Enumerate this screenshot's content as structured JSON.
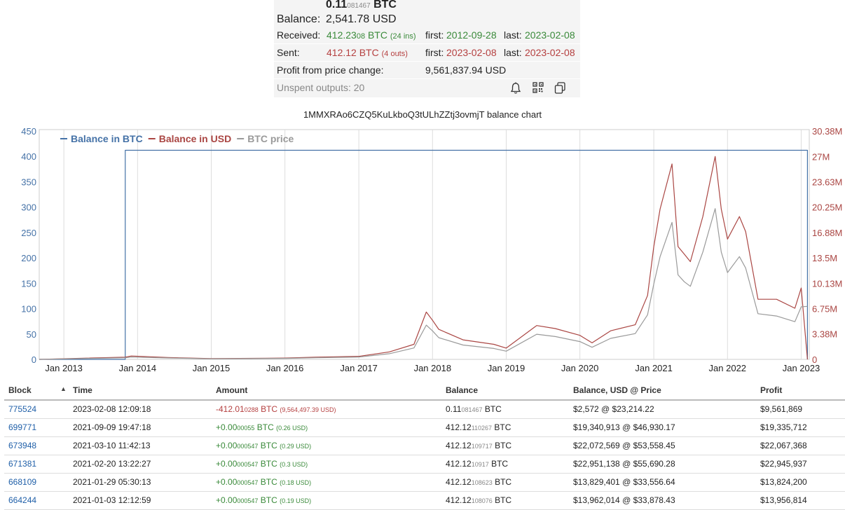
{
  "summary": {
    "btc_main": "0.11",
    "btc_small": "081467",
    "btc_unit": "BTC",
    "balance_label": "Balance:",
    "balance_value": "2,541.78 USD",
    "received_label": "Received:",
    "received_main": "412.23",
    "received_small": "08",
    "received_unit": "BTC",
    "received_ins": "(24 ins)",
    "first_label": "first:",
    "last_label": "last:",
    "received_first": "2012-09-28",
    "received_last": "2023-02-08",
    "sent_label": "Sent:",
    "sent_value": "412.12 BTC",
    "sent_outs": "(4 outs)",
    "sent_first": "2023-02-08",
    "sent_last": "2023-02-08",
    "profit_label": "Profit from price change:",
    "profit_value": "9,561,837.94 USD",
    "unspent_label": "Unspent outputs: 20",
    "icons": [
      "bell-icon",
      "qr-code-icon",
      "copy-icon"
    ]
  },
  "chart_title": "1MMXRAo6CZQ5KuLkboQ3tULhZZtj3ovmjT balance chart",
  "chart_data": {
    "type": "line",
    "x": [
      "2012-09",
      "2013-11",
      "2013-12",
      "2014-06",
      "2015-01",
      "2016-01",
      "2016-06",
      "2017-01",
      "2017-06",
      "2017-10",
      "2017-12",
      "2018-01",
      "2018-02",
      "2018-06",
      "2018-11",
      "2019-01",
      "2019-06",
      "2019-09",
      "2020-01",
      "2020-03",
      "2020-06",
      "2020-10",
      "2020-12",
      "2021-01",
      "2021-02",
      "2021-04",
      "2021-05",
      "2021-06",
      "2021-07",
      "2021-09",
      "2021-11",
      "2021-12",
      "2022-01",
      "2022-03",
      "2022-04",
      "2022-06",
      "2022-09",
      "2022-12",
      "2023-01",
      "2023-02"
    ],
    "series": [
      {
        "name": "Balance in BTC",
        "color": "#4572a7",
        "values": [
          0,
          412,
          412,
          412,
          412,
          412,
          412,
          412,
          412,
          412,
          412,
          412,
          412,
          412,
          412,
          412,
          412,
          412,
          412,
          412,
          412,
          412,
          412,
          412,
          412,
          412,
          412,
          412,
          412,
          412,
          412,
          412,
          412,
          412,
          412,
          412,
          412,
          412,
          412,
          0.11
        ]
      },
      {
        "name": "Balance in USD",
        "color": "#aa4643",
        "values": [
          0,
          0.3,
          0.45,
          0.25,
          0.1,
          0.18,
          0.3,
          0.4,
          1.0,
          2.0,
          6.3,
          5.2,
          4.0,
          2.6,
          2.0,
          1.5,
          4.5,
          4.1,
          3.2,
          2.2,
          3.8,
          4.6,
          8.5,
          15.0,
          20.0,
          26.0,
          15.0,
          14.0,
          13.0,
          19.0,
          27.0,
          20.0,
          16.0,
          19.0,
          17.0,
          8.0,
          8.0,
          6.8,
          9.5,
          0.003
        ]
      },
      {
        "name": "BTC price",
        "color": "#9a9a9a",
        "values": [
          12,
          700,
          1000,
          600,
          250,
          430,
          700,
          1000,
          2500,
          5000,
          15000,
          12500,
          9500,
          6300,
          4800,
          3600,
          11000,
          10000,
          7800,
          5300,
          9200,
          11300,
          19500,
          33000,
          45000,
          60000,
          37000,
          34000,
          32000,
          47000,
          66000,
          47000,
          38000,
          45000,
          40000,
          20000,
          19000,
          16500,
          23000,
          23214
        ]
      }
    ],
    "x_ticks": [
      "Jan 2013",
      "Jan 2014",
      "Jan 2015",
      "Jan 2016",
      "Jan 2017",
      "Jan 2018",
      "Jan 2019",
      "Jan 2020",
      "Jan 2021",
      "Jan 2022",
      "Jan 2023"
    ],
    "y_left_ticks": [
      "0",
      "50",
      "100",
      "150",
      "200",
      "250",
      "300",
      "350",
      "400",
      "450"
    ],
    "y_right_ticks": [
      "0",
      "3.38M",
      "6.75M",
      "10.13M",
      "13.5M",
      "16.88M",
      "20.25M",
      "23.63M",
      "27M",
      "30.38M"
    ],
    "ylim_left": [
      0,
      450
    ],
    "ylim_right": [
      0,
      30.38
    ],
    "ylim_price": [
      0,
      100000
    ],
    "legend_position": "top-left",
    "grid": "vertical"
  },
  "table": {
    "headers": [
      "Block",
      "Time",
      "Amount",
      "Balance",
      "Balance, USD @ Price",
      "Profit"
    ],
    "rows": [
      {
        "block": "775524",
        "time": "2023-02-08 12:09:18",
        "amt_main": "-412.01",
        "amt_small": "0288",
        "amt_unit": " BTC",
        "amt_usd": "(9,564,497.39 USD)",
        "amt_sign": "neg",
        "bal_main": "0.11",
        "bal_small": "081467",
        "bal_unit": " BTC",
        "bal_usd": "$2,572 @ $23,214.22",
        "profit": "$9,561,869"
      },
      {
        "block": "699771",
        "time": "2021-09-09 19:47:18",
        "amt_main": "+0.00",
        "amt_small": "00055",
        "amt_unit": " BTC",
        "amt_usd": "(0.26 USD)",
        "amt_sign": "pos",
        "bal_main": "412.12",
        "bal_small": "110267",
        "bal_unit": " BTC",
        "bal_usd": "$19,340,913 @ $46,930.17",
        "profit": "$19,335,712"
      },
      {
        "block": "673948",
        "time": "2021-03-10 11:42:13",
        "amt_main": "+0.00",
        "amt_small": "000547",
        "amt_unit": " BTC",
        "amt_usd": "(0.29 USD)",
        "amt_sign": "pos",
        "bal_main": "412.12",
        "bal_small": "109717",
        "bal_unit": " BTC",
        "bal_usd": "$22,072,569 @ $53,558.45",
        "profit": "$22,067,368"
      },
      {
        "block": "671381",
        "time": "2021-02-20 13:22:27",
        "amt_main": "+0.00",
        "amt_small": "000547",
        "amt_unit": " BTC",
        "amt_usd": "(0.3 USD)",
        "amt_sign": "pos",
        "bal_main": "412.12",
        "bal_small": "10917",
        "bal_unit": " BTC",
        "bal_usd": "$22,951,138 @ $55,690.28",
        "profit": "$22,945,937"
      },
      {
        "block": "668109",
        "time": "2021-01-29 05:30:13",
        "amt_main": "+0.00",
        "amt_small": "000547",
        "amt_unit": " BTC",
        "amt_usd": "(0.18 USD)",
        "amt_sign": "pos",
        "bal_main": "412.12",
        "bal_small": "108623",
        "bal_unit": " BTC",
        "bal_usd": "$13,829,401 @ $33,556.64",
        "profit": "$13,824,200"
      },
      {
        "block": "664244",
        "time": "2021-01-03 12:12:59",
        "amt_main": "+0.00",
        "amt_small": "000547",
        "amt_unit": " BTC",
        "amt_usd": "(0.19 USD)",
        "amt_sign": "pos",
        "bal_main": "412.12",
        "bal_small": "108076",
        "bal_unit": " BTC",
        "bal_usd": "$13,962,014 @ $33,878.43",
        "profit": "$13,956,814"
      }
    ]
  }
}
